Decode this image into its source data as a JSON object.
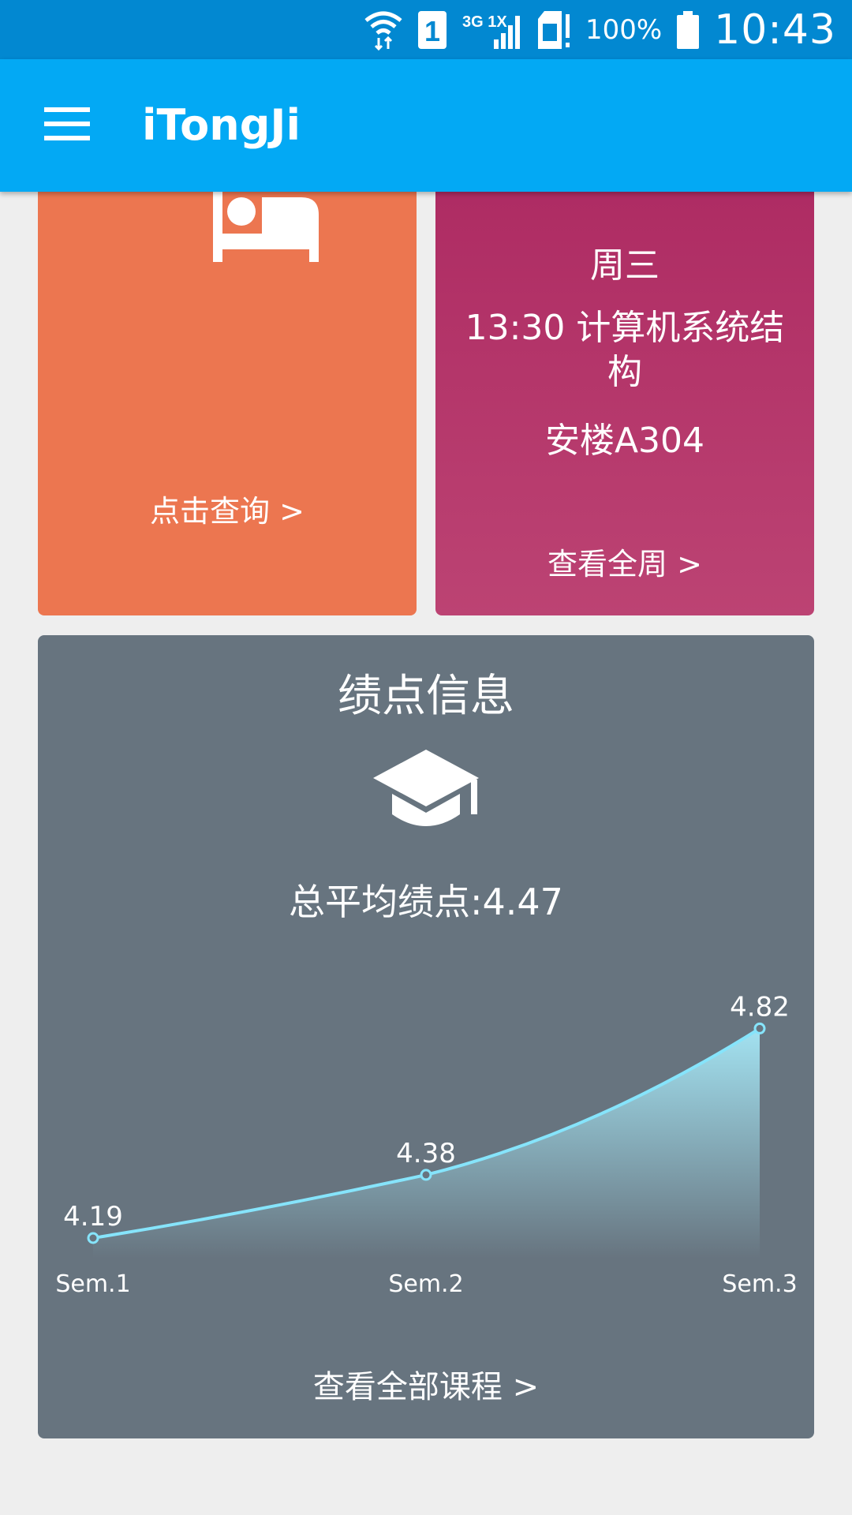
{
  "status_bar": {
    "network": "3G 1X",
    "sim_slot": "1",
    "battery": "100%",
    "time": "10:43"
  },
  "app_bar": {
    "title": "iTongJi",
    "menu_icon": "hamburger-menu-icon"
  },
  "dorm_card": {
    "icon": "bed-icon",
    "link_label": "点击查询 >",
    "color": "#ec7650"
  },
  "schedule_card": {
    "day": "周三",
    "course": "13:30  计算机系统结构",
    "room": "安楼A304",
    "link_label": "查看全周 >",
    "color": "#b03266"
  },
  "gpa_card": {
    "title": "绩点信息",
    "icon": "graduation-cap-icon",
    "average_label": "总平均绩点:4.47",
    "link_label": "查看全部课程 >",
    "color": "#67747f"
  },
  "chart_data": {
    "type": "area",
    "categories": [
      "Sem.1",
      "Sem.2",
      "Sem.3"
    ],
    "values": [
      4.19,
      4.38,
      4.82
    ],
    "data_labels": [
      "4.19",
      "4.38",
      "4.82"
    ],
    "line_color": "#86e4fb",
    "grid": false
  }
}
